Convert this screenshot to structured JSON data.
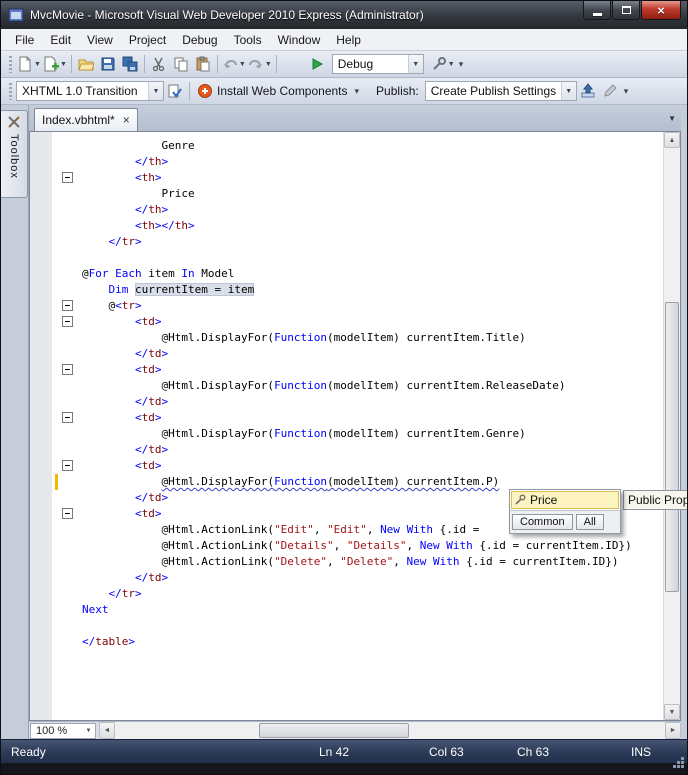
{
  "window": {
    "title": "MvcMovie - Microsoft Visual Web Developer 2010 Express (Administrator)"
  },
  "icons": {
    "dropdown_arrow": "▼",
    "overflow_chevron": "▾",
    "close_glyph": "×",
    "scroll_up": "▲",
    "scroll_down": "▼",
    "scroll_left": "◄",
    "scroll_right": "►"
  },
  "menu": {
    "items": [
      "File",
      "Edit",
      "View",
      "Project",
      "Debug",
      "Tools",
      "Window",
      "Help"
    ]
  },
  "toolbar1": {
    "debug_combo_value": "Debug"
  },
  "toolbar2": {
    "doctype_combo_value": "XHTML 1.0 Transition",
    "install_label": "Install Web Components",
    "publish_label": "Publish:",
    "publish_combo_value": "Create Publish Settings"
  },
  "tabstrip": {
    "active_tab": "Index.vbhtml*"
  },
  "toolbox": {
    "label": "Toolbox"
  },
  "editor": {
    "lines": [
      {
        "segs": [
          [
            "p",
            "            Genre"
          ]
        ]
      },
      {
        "segs": [
          [
            "p",
            "        "
          ],
          [
            "d",
            "</"
          ],
          [
            "t",
            "th"
          ],
          [
            "d",
            ">"
          ]
        ]
      },
      {
        "fold": true,
        "segs": [
          [
            "p",
            "        "
          ],
          [
            "d",
            "<"
          ],
          [
            "t",
            "th"
          ],
          [
            "d",
            ">"
          ]
        ]
      },
      {
        "segs": [
          [
            "p",
            "            Price"
          ]
        ]
      },
      {
        "segs": [
          [
            "p",
            "        "
          ],
          [
            "d",
            "</"
          ],
          [
            "t",
            "th"
          ],
          [
            "d",
            ">"
          ]
        ]
      },
      {
        "segs": [
          [
            "p",
            "        "
          ],
          [
            "d",
            "<"
          ],
          [
            "t",
            "th"
          ],
          [
            "d",
            ">"
          ],
          [
            "d",
            "</"
          ],
          [
            "t",
            "th"
          ],
          [
            "d",
            ">"
          ]
        ]
      },
      {
        "segs": [
          [
            "p",
            "    "
          ],
          [
            "d",
            "</"
          ],
          [
            "t",
            "tr"
          ],
          [
            "d",
            ">"
          ]
        ]
      },
      {
        "segs": []
      },
      {
        "segs": [
          [
            "p",
            "@"
          ],
          [
            "k",
            "For"
          ],
          [
            "p",
            " "
          ],
          [
            "k",
            "Each"
          ],
          [
            "p",
            " item "
          ],
          [
            "k",
            "In"
          ],
          [
            "p",
            " Model"
          ]
        ]
      },
      {
        "segs": [
          [
            "p",
            "    "
          ],
          [
            "k",
            "Dim"
          ],
          [
            "p",
            " "
          ],
          [
            "p hl",
            "currentItem = item"
          ]
        ]
      },
      {
        "fold": true,
        "segs": [
          [
            "p",
            "    @"
          ],
          [
            "d",
            "<"
          ],
          [
            "t",
            "tr"
          ],
          [
            "d",
            ">"
          ]
        ]
      },
      {
        "fold": true,
        "segs": [
          [
            "p",
            "        "
          ],
          [
            "d",
            "<"
          ],
          [
            "t",
            "td"
          ],
          [
            "d",
            ">"
          ]
        ]
      },
      {
        "segs": [
          [
            "p",
            "            @Html.DisplayFor("
          ],
          [
            "k",
            "Function"
          ],
          [
            "p",
            "(modelItem) currentItem.Title)"
          ]
        ]
      },
      {
        "segs": [
          [
            "p",
            "        "
          ],
          [
            "d",
            "</"
          ],
          [
            "t",
            "td"
          ],
          [
            "d",
            ">"
          ]
        ]
      },
      {
        "fold": true,
        "segs": [
          [
            "p",
            "        "
          ],
          [
            "d",
            "<"
          ],
          [
            "t",
            "td"
          ],
          [
            "d",
            ">"
          ]
        ]
      },
      {
        "segs": [
          [
            "p",
            "            @Html.DisplayFor("
          ],
          [
            "k",
            "Function"
          ],
          [
            "p",
            "(modelItem) currentItem.ReleaseDate)"
          ]
        ]
      },
      {
        "segs": [
          [
            "p",
            "        "
          ],
          [
            "d",
            "</"
          ],
          [
            "t",
            "td"
          ],
          [
            "d",
            ">"
          ]
        ]
      },
      {
        "fold": true,
        "segs": [
          [
            "p",
            "        "
          ],
          [
            "d",
            "<"
          ],
          [
            "t",
            "td"
          ],
          [
            "d",
            ">"
          ]
        ]
      },
      {
        "segs": [
          [
            "p",
            "            @Html.DisplayFor("
          ],
          [
            "k",
            "Function"
          ],
          [
            "p",
            "(modelItem) currentItem.Genre)"
          ]
        ]
      },
      {
        "segs": [
          [
            "p",
            "        "
          ],
          [
            "d",
            "</"
          ],
          [
            "t",
            "td"
          ],
          [
            "d",
            ">"
          ]
        ]
      },
      {
        "fold": true,
        "segs": [
          [
            "p",
            "        "
          ],
          [
            "d",
            "<"
          ],
          [
            "t",
            "td"
          ],
          [
            "d",
            ">"
          ]
        ]
      },
      {
        "change": true,
        "segs": [
          [
            "p",
            "            "
          ],
          [
            "p sq",
            "@Html.DisplayFor("
          ],
          [
            "k sq",
            "Function"
          ],
          [
            "p sq",
            "(modelItem) currentItem.P)"
          ]
        ]
      },
      {
        "segs": [
          [
            "p",
            "        "
          ],
          [
            "d",
            "</"
          ],
          [
            "t",
            "td"
          ],
          [
            "d",
            ">"
          ]
        ]
      },
      {
        "fold": true,
        "segs": [
          [
            "p",
            "        "
          ],
          [
            "d",
            "<"
          ],
          [
            "t",
            "td"
          ],
          [
            "d",
            ">"
          ]
        ]
      },
      {
        "segs": [
          [
            "p",
            "            @Html.ActionLink("
          ],
          [
            "s",
            "\"Edit\""
          ],
          [
            "p",
            ", "
          ],
          [
            "s",
            "\"Edit\""
          ],
          [
            "p",
            ", "
          ],
          [
            "k",
            "New"
          ],
          [
            "p",
            " "
          ],
          [
            "k",
            "With"
          ],
          [
            "p",
            " {.id = "
          ]
        ]
      },
      {
        "segs": [
          [
            "p",
            "            @Html.ActionLink("
          ],
          [
            "s",
            "\"Details\""
          ],
          [
            "p",
            ", "
          ],
          [
            "s",
            "\"Details\""
          ],
          [
            "p",
            ", "
          ],
          [
            "k",
            "New"
          ],
          [
            "p",
            " "
          ],
          [
            "k",
            "With"
          ],
          [
            "p",
            " {.id = currentItem.ID})"
          ]
        ]
      },
      {
        "segs": [
          [
            "p",
            "            @Html.ActionLink("
          ],
          [
            "s",
            "\"Delete\""
          ],
          [
            "p",
            ", "
          ],
          [
            "s",
            "\"Delete\""
          ],
          [
            "p",
            ", "
          ],
          [
            "k",
            "New"
          ],
          [
            "p",
            " "
          ],
          [
            "k",
            "With"
          ],
          [
            "p",
            " {.id = currentItem.ID})"
          ]
        ]
      },
      {
        "segs": [
          [
            "p",
            "        "
          ],
          [
            "d",
            "</"
          ],
          [
            "t",
            "td"
          ],
          [
            "d",
            ">"
          ]
        ]
      },
      {
        "segs": [
          [
            "p",
            "    "
          ],
          [
            "d",
            "</"
          ],
          [
            "t",
            "tr"
          ],
          [
            "d",
            ">"
          ]
        ]
      },
      {
        "segs": [
          [
            "k",
            "Next"
          ]
        ]
      },
      {
        "segs": []
      },
      {
        "segs": [
          [
            "d",
            "</"
          ],
          [
            "t",
            "table"
          ],
          [
            "d",
            ">"
          ]
        ]
      }
    ]
  },
  "intellisense": {
    "selected_item": "Price",
    "tabs": [
      "Common",
      "All"
    ],
    "tooltip": "Public Prop"
  },
  "bottombar": {
    "zoom_value": "100 %"
  },
  "statusbar": {
    "ready": "Ready",
    "line": "Ln 42",
    "column": "Col 63",
    "character": "Ch 63",
    "mode": "INS"
  },
  "colors": {
    "keyword": "#0000ff",
    "html_tag": "#800000",
    "html_delimiter": "#0000ff",
    "string": "#a31515",
    "change_bar": "#F2B705",
    "statusbar_bg": "#293955",
    "close_button": "#c0392b",
    "intellisense_selection": "#FCF3BE"
  }
}
